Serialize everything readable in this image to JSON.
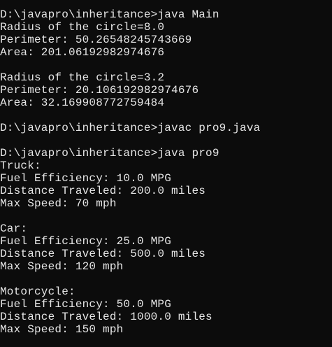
{
  "terminal": {
    "lines": [
      "D:\\javapro\\inheritance>java Main",
      "Radius of the circle=8.0",
      "Perimeter: 50.26548245743669",
      "Area: 201.06192982974676",
      "",
      "Radius of the circle=3.2",
      "Perimeter: 20.106192982974676",
      "Area: 32.169908772759484",
      "",
      "D:\\javapro\\inheritance>javac pro9.java",
      "",
      "D:\\javapro\\inheritance>java pro9",
      "Truck:",
      "Fuel Efficiency: 10.0 MPG",
      "Distance Traveled: 200.0 miles",
      "Max Speed: 70 mph",
      "",
      "Car:",
      "Fuel Efficiency: 25.0 MPG",
      "Distance Traveled: 500.0 miles",
      "Max Speed: 120 mph",
      "",
      "Motorcycle:",
      "Fuel Efficiency: 50.0 MPG",
      "Distance Traveled: 1000.0 miles",
      "Max Speed: 150 mph"
    ]
  }
}
